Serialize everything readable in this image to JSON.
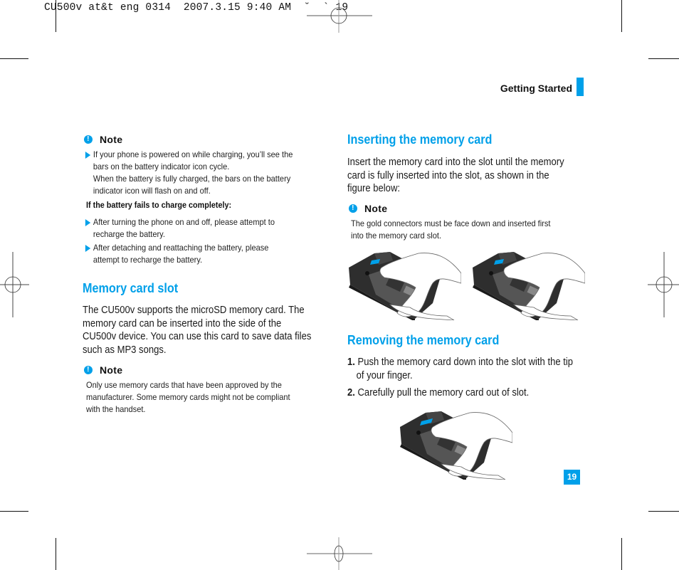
{
  "slug": {
    "text": "CU500v at&t eng 0314  2007.3.15 9:40 AM  ˘  ` 19"
  },
  "header": {
    "section_title": "Getting Started",
    "accent_color": "#00a0e9"
  },
  "left_column": {
    "note1": {
      "icon": "exclamation-circle-icon",
      "title": "Note",
      "bullets": [
        {
          "lines": [
            "If your phone is powered on while charging, you’ll see the",
            "bars on the battery indicator icon cycle.",
            "When the battery is fully charged, the bars on the battery",
            "indicator icon will flash on and off."
          ]
        }
      ],
      "subheading": "If the battery fails to charge completely:",
      "sub_bullets": [
        {
          "line1": "After turning the phone on and off, please attempt to",
          "line2": "recharge the battery."
        },
        {
          "line1": "After detaching and reattaching the battery, please",
          "line2": "attempt to recharge the battery."
        }
      ]
    },
    "memory_card_slot": {
      "heading": "Memory card slot",
      "body": [
        "The CU500v supports the microSD memory card. The",
        "memory card can be inserted into the side of the",
        "CU500v device. You can use this card to save data files",
        "such as MP3 songs."
      ],
      "note": {
        "icon": "exclamation-circle-icon",
        "title": "Note",
        "lines": [
          "Only use memory cards that have been approved by the",
          "manufacturer. Some memory cards might not be compliant",
          "with the handset."
        ]
      }
    }
  },
  "right_column": {
    "inserting": {
      "heading": "Inserting the memory card",
      "body": [
        "Insert the memory card into the slot until the memory",
        "card is fully inserted into the slot, as shown in the",
        "figure below:"
      ],
      "note": {
        "icon": "exclamation-circle-icon",
        "title": "Note",
        "lines": [
          "The gold connectors must be face down and inserted first",
          "into the memory card slot."
        ]
      },
      "figures": [
        "phone-insert-card-illustration-1",
        "phone-insert-card-illustration-2"
      ]
    },
    "removing": {
      "heading": "Removing the memory card",
      "steps": [
        {
          "num": "1.",
          "line1": "Push the memory card down into the slot with the tip",
          "line2": "of your finger."
        },
        {
          "num": "2.",
          "line1": "Carefully pull the memory card out of slot.",
          "line2": ""
        }
      ],
      "figure": "phone-remove-card-illustration"
    }
  },
  "footer": {
    "page_number": "19"
  }
}
